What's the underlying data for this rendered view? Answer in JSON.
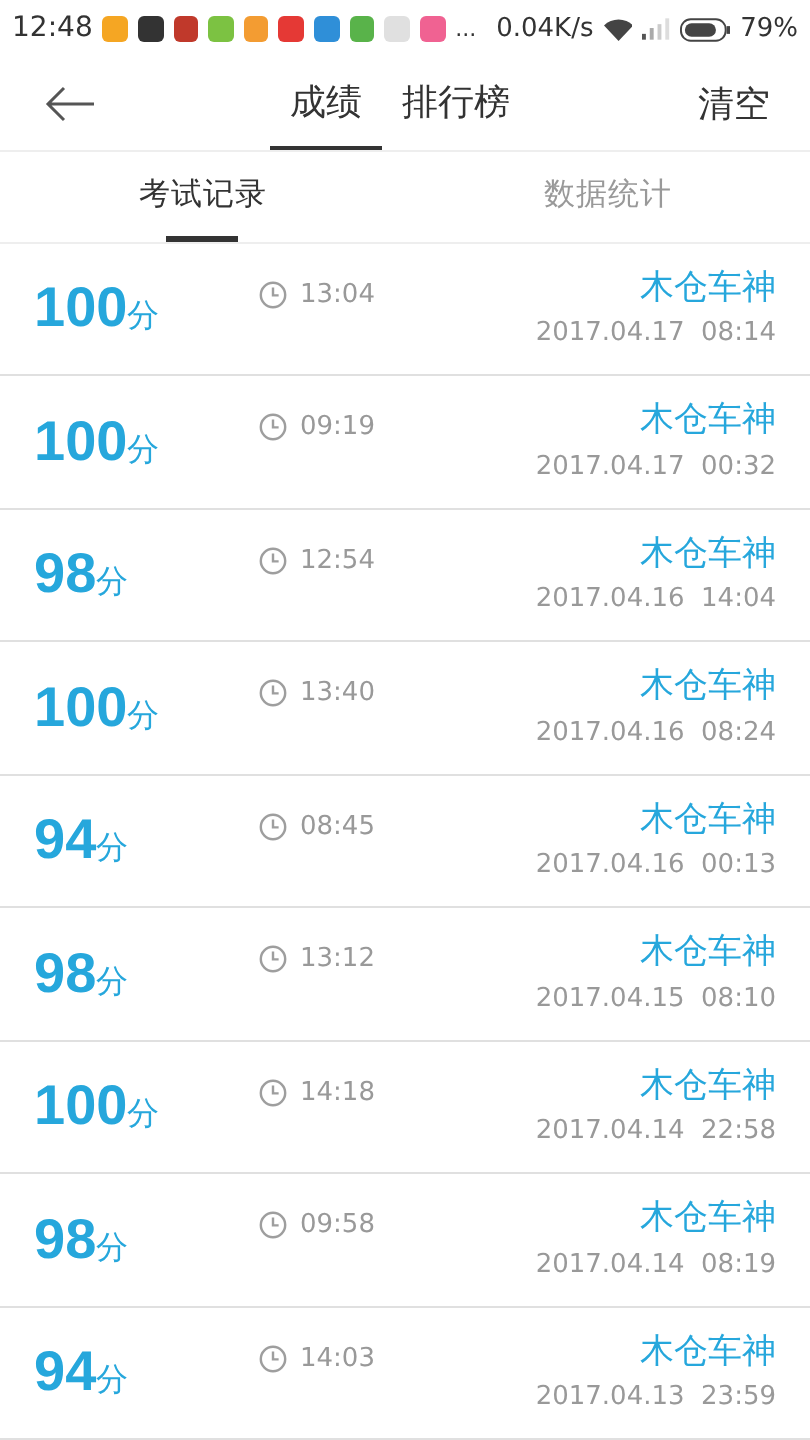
{
  "status_bar": {
    "time": "12:48",
    "more": "...",
    "speed": "0.04K/s",
    "battery": "79%"
  },
  "header": {
    "tabs": [
      {
        "label": "成绩",
        "selected": true
      },
      {
        "label": "排行榜",
        "selected": false
      }
    ],
    "action": "清空"
  },
  "subtabs": [
    {
      "label": "考试记录",
      "selected": true
    },
    {
      "label": "数据统计",
      "selected": false
    }
  ],
  "records": [
    {
      "score": "100",
      "unit": "分",
      "duration": "13:04",
      "name": "木仓车神",
      "date": "2017.04.17  08:14"
    },
    {
      "score": "100",
      "unit": "分",
      "duration": "09:19",
      "name": "木仓车神",
      "date": "2017.04.17  00:32"
    },
    {
      "score": "98",
      "unit": "分",
      "duration": "12:54",
      "name": "木仓车神",
      "date": "2017.04.16  14:04"
    },
    {
      "score": "100",
      "unit": "分",
      "duration": "13:40",
      "name": "木仓车神",
      "date": "2017.04.16  08:24"
    },
    {
      "score": "94",
      "unit": "分",
      "duration": "08:45",
      "name": "木仓车神",
      "date": "2017.04.16  00:13"
    },
    {
      "score": "98",
      "unit": "分",
      "duration": "13:12",
      "name": "木仓车神",
      "date": "2017.04.15  08:10"
    },
    {
      "score": "100",
      "unit": "分",
      "duration": "14:18",
      "name": "木仓车神",
      "date": "2017.04.14  22:58"
    },
    {
      "score": "98",
      "unit": "分",
      "duration": "09:58",
      "name": "木仓车神",
      "date": "2017.04.14  08:19"
    },
    {
      "score": "94",
      "unit": "分",
      "duration": "14:03",
      "name": "木仓车神",
      "date": "2017.04.13  23:59"
    }
  ]
}
